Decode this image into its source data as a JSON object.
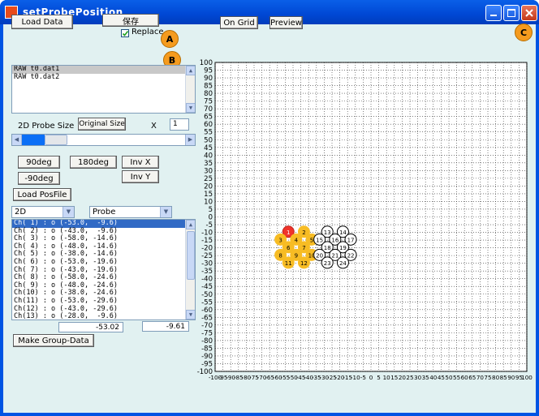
{
  "window": {
    "title": "setProbePosition"
  },
  "buttons": {
    "load_data": "Load Data",
    "save": "保存",
    "on_grid": "On Grid",
    "preview": "Preview",
    "original_size": "Original Size",
    "rot90": "90deg",
    "rot180": "180deg",
    "rotm90": "-90deg",
    "invx": "Inv X",
    "invy": "Inv Y",
    "load_posfile": "Load PosFile",
    "make_group": "Make Group-Data"
  },
  "replace": {
    "label": "Replace",
    "checked": true
  },
  "markers": {
    "a": "A",
    "b": "B",
    "c": "C"
  },
  "files": [
    "RAW t0.dat1",
    "RAW t0.dat2"
  ],
  "probe_size": {
    "label": "2D Probe Size",
    "x_label": "X",
    "value": "1"
  },
  "dim_select": "2D",
  "probe_select": "Probe",
  "channels": [
    "Ch( 1) : o (-53.0,  -9.6)",
    "Ch( 2) : o (-43.0,  -9.6)",
    "Ch( 3) : o (-58.0, -14.6)",
    "Ch( 4) : o (-48.0, -14.6)",
    "Ch( 5) : o (-38.0, -14.6)",
    "Ch( 6) : o (-53.0, -19.6)",
    "Ch( 7) : o (-43.0, -19.6)",
    "Ch( 8) : o (-58.0, -24.6)",
    "Ch( 9) : o (-48.0, -24.6)",
    "Ch(10) : o (-38.0, -24.6)",
    "Ch(11) : o (-53.0, -29.6)",
    "Ch(12) : o (-43.0, -29.6)",
    "Ch(13) : o (-28.0,  -9.6)"
  ],
  "coord_x": "-53.02",
  "coord_y": "-9.61",
  "plot": {
    "y_ticks": [
      "100",
      "95",
      "90",
      "85",
      "80",
      "75",
      "70",
      "65",
      "60",
      "55",
      "50",
      "45",
      "40",
      "35",
      "30",
      "25",
      "20",
      "15",
      "10",
      "5",
      "0",
      "-5",
      "-10",
      "-15",
      "-20",
      "-25",
      "-30",
      "-35",
      "-40",
      "-45",
      "-50",
      "-55",
      "-60",
      "-65",
      "-70",
      "-75",
      "-80",
      "-85",
      "-90",
      "-95",
      "-100"
    ],
    "x_ticks": [
      "-100",
      "-95",
      "-90",
      "-85",
      "-80",
      "-75",
      "-70",
      "-65",
      "-60",
      "-55",
      "-50",
      "-45",
      "-40",
      "-35",
      "-30",
      "-25",
      "-20",
      "-15",
      "-10",
      "-5",
      "0",
      "5",
      "10",
      "15",
      "20",
      "25",
      "30",
      "35",
      "40",
      "45",
      "50",
      "55",
      "60",
      "65",
      "70",
      "75",
      "80",
      "85",
      "90",
      "95",
      "100"
    ],
    "probe_a": [
      {
        "n": "1",
        "x": -53,
        "y": -9.6,
        "sel": true
      },
      {
        "n": "2",
        "x": -43,
        "y": -9.6
      },
      {
        "n": "3",
        "x": -58,
        "y": -14.6
      },
      {
        "n": "4",
        "x": -48,
        "y": -14.6
      },
      {
        "n": "5",
        "x": -38,
        "y": -14.6
      },
      {
        "n": "6",
        "x": -53,
        "y": -19.6
      },
      {
        "n": "7",
        "x": -43,
        "y": -19.6
      },
      {
        "n": "8",
        "x": -58,
        "y": -24.6
      },
      {
        "n": "9",
        "x": -48,
        "y": -24.6
      },
      {
        "n": "10",
        "x": -38,
        "y": -24.6
      },
      {
        "n": "11",
        "x": -53,
        "y": -29.6
      },
      {
        "n": "12",
        "x": -43,
        "y": -29.6
      }
    ],
    "probe_b": [
      {
        "n": "13",
        "x": -28,
        "y": -9.6
      },
      {
        "n": "14",
        "x": -18,
        "y": -9.6
      },
      {
        "n": "15",
        "x": -33,
        "y": -14.6
      },
      {
        "n": "16",
        "x": -23,
        "y": -14.6
      },
      {
        "n": "17",
        "x": -13,
        "y": -14.6
      },
      {
        "n": "18",
        "x": -28,
        "y": -19.6
      },
      {
        "n": "19",
        "x": -18,
        "y": -19.6
      },
      {
        "n": "20",
        "x": -33,
        "y": -24.6
      },
      {
        "n": "21",
        "x": -23,
        "y": -24.6
      },
      {
        "n": "22",
        "x": -13,
        "y": -24.6
      },
      {
        "n": "23",
        "x": -28,
        "y": -29.6
      },
      {
        "n": "24",
        "x": -18,
        "y": -29.6
      }
    ]
  }
}
